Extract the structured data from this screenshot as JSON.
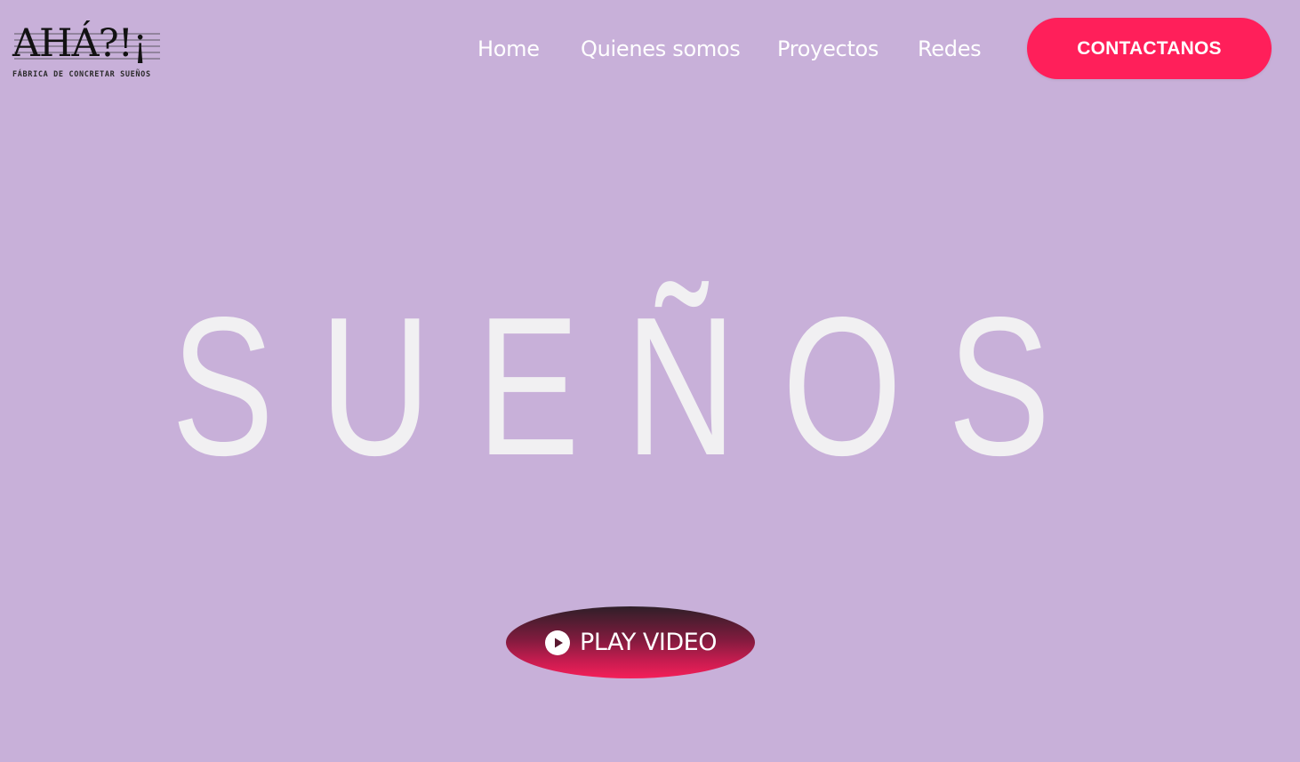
{
  "logo": {
    "mark": "AHÁ?!¡",
    "tagline": "FÁBRICA DE CONCRETAR SUEÑOS"
  },
  "nav": {
    "items": [
      {
        "label": "Home"
      },
      {
        "label": "Quienes somos"
      },
      {
        "label": "Proyectos"
      },
      {
        "label": "Redes"
      }
    ],
    "cta_label": "CONTACTANOS"
  },
  "hero": {
    "headline": "SUEÑOS",
    "play_label": "PLAY VIDEO"
  },
  "colors": {
    "background": "#c8b0d9",
    "accent": "#ff1f5a",
    "hero_text": "#f1f0f2"
  },
  "icons": {
    "play": "play-circle-icon"
  }
}
